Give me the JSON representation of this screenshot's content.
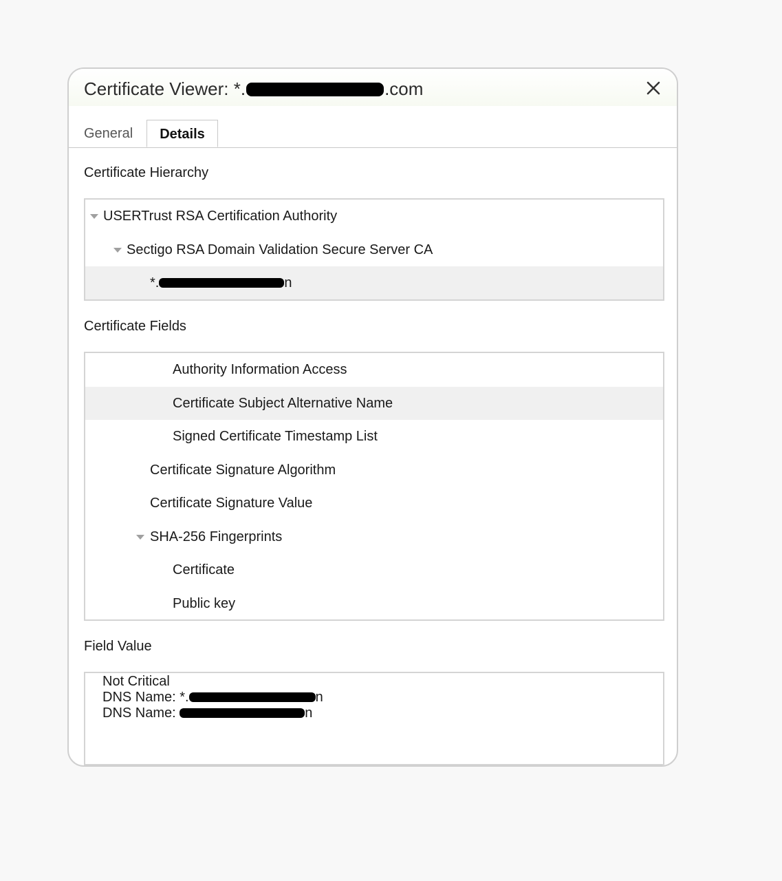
{
  "dialog": {
    "title_prefix": "Certificate Viewer: *.",
    "title_suffix": ".com",
    "close_label": "✕"
  },
  "tabs": [
    {
      "label": "General",
      "active": false
    },
    {
      "label": "Details",
      "active": true
    }
  ],
  "hierarchy": {
    "label": "Certificate Hierarchy",
    "items": [
      {
        "label": "USERTrust RSA Certification Authority",
        "expanded": true
      },
      {
        "label": "Sectigo RSA Domain Validation Secure Server CA",
        "expanded": true
      },
      {
        "label_prefix": "*.",
        "label_suffix": "n",
        "selected": true
      }
    ]
  },
  "fields": {
    "label": "Certificate Fields",
    "items": [
      {
        "label": "Authority Information Access"
      },
      {
        "label": "Certificate Subject Alternative Name",
        "selected": true
      },
      {
        "label": "Signed Certificate Timestamp List"
      },
      {
        "label": "Certificate Signature Algorithm"
      },
      {
        "label": "Certificate Signature Value"
      },
      {
        "label": "SHA-256 Fingerprints",
        "expanded": true
      },
      {
        "label": "Certificate"
      },
      {
        "label": "Public key"
      }
    ]
  },
  "field_value": {
    "label": "Field Value",
    "line1": "Not Critical",
    "line2_prefix": "DNS Name: *.",
    "line2_suffix": "n",
    "line3_prefix": "DNS Name: ",
    "line3_suffix": "n"
  },
  "colors": {
    "selected_row": "#f0f0f0",
    "border": "#d4d4d4",
    "redaction": "#000000"
  }
}
